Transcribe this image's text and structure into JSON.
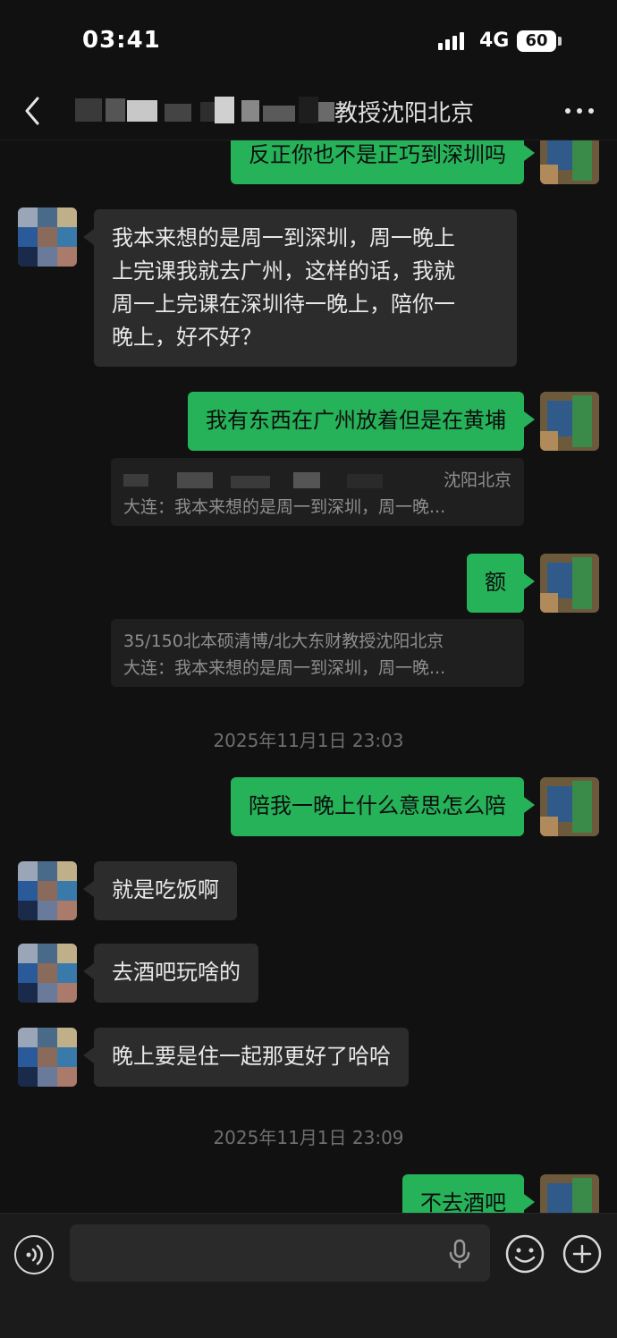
{
  "status_bar": {
    "time": "03:41",
    "network": "4G",
    "battery": "60"
  },
  "nav": {
    "title_visible": "教授沈阳北京",
    "back_icon": "chevron-left-icon",
    "more_icon": "more-dots-icon"
  },
  "messages": [
    {
      "side": "out",
      "text": "反正你也不是正巧到深圳吗"
    },
    {
      "side": "in",
      "lines": [
        "我本来想的是周一到深圳，周一晚上",
        "上完课我就去广州，这样的话，我就",
        "周一上完课在深圳待一晚上，陪你一",
        "晚上，好不好？"
      ]
    },
    {
      "side": "out",
      "text": "我有东西在广州放着但是在黄埔"
    },
    {
      "side": "quote",
      "line1": "沈阳北京",
      "line2": "大连：我本来想的是周一到深圳，周一晚..."
    },
    {
      "side": "out",
      "text": "额"
    },
    {
      "side": "quote",
      "line1": "35/150北本硕清博/北大东财教授沈阳北京",
      "line2": "大连：我本来想的是周一到深圳，周一晚..."
    },
    {
      "side": "time",
      "text": "2025年11月1日 23:03"
    },
    {
      "side": "out",
      "text": "陪我一晚上什么意思怎么陪"
    },
    {
      "side": "in",
      "text": "就是吃饭啊"
    },
    {
      "side": "in",
      "text": "去酒吧玩啥的"
    },
    {
      "side": "in",
      "text": "晚上要是住一起那更好了哈哈"
    },
    {
      "side": "time",
      "text": "2025年11月1日 23:09"
    },
    {
      "side": "out",
      "text": "不去酒吧"
    }
  ],
  "input_bar": {
    "voice_icon": "voice-toggle-icon",
    "placeholder": "",
    "mic_icon": "microphone-icon",
    "emoji_icon": "emoji-icon",
    "plus_icon": "plus-icon"
  },
  "colors": {
    "background": "#111111",
    "bubble_out": "#26b259",
    "bubble_in": "#2c2c2c",
    "quote_bg": "#1f1f1f"
  }
}
